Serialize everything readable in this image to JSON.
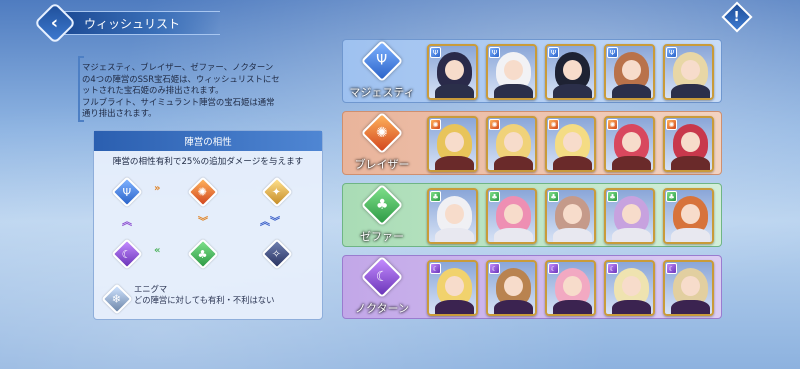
{
  "header": {
    "title": "ウィッシュリスト",
    "back_icon": "chevron-left-icon",
    "info_icon": "exclamation-icon"
  },
  "description": {
    "lines": [
      "マジェスティ、ブレイザー、ゼファー、ノクターン",
      "の4つの陣営のSSR宝石姫は、ウィッシュリストにセ",
      "ットされた宝石姫のみ排出されます。",
      "フルブライト、サイミュラント陣営の宝石姫は通常",
      "通り排出されます。"
    ]
  },
  "affinity": {
    "title": "陣営の相性",
    "subtitle": "陣営の相性有利で25%の追加ダメージを与えます",
    "enigma_label": "エニグマ",
    "enigma_desc": "どの陣営に対しても有利・不利はない"
  },
  "factions": [
    {
      "name": "マジェスティ",
      "icon": "trident-icon",
      "color": "#2a63c9"
    },
    {
      "name": "ブレイザー",
      "icon": "flame-icon",
      "color": "#d2461e"
    },
    {
      "name": "ゼファー",
      "icon": "tree-icon",
      "color": "#2d9a45"
    },
    {
      "name": "ノクターン",
      "icon": "moon-icon",
      "color": "#6a34b8"
    }
  ],
  "cards_per_row": 5,
  "colors": {
    "card_border": "#c99b3a",
    "accent": "#2b5fb0"
  }
}
